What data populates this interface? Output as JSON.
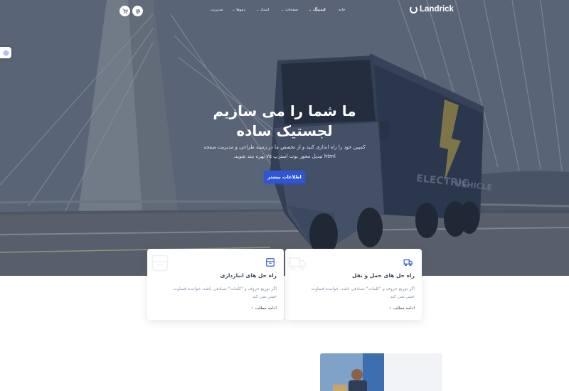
{
  "brand": {
    "name": "Landrick"
  },
  "nav": {
    "items": [
      {
        "label": "خانه",
        "active": false,
        "caret": false
      },
      {
        "label": "لندینگ",
        "active": true,
        "caret": true
      },
      {
        "label": "صفحات",
        "active": false,
        "caret": true
      },
      {
        "label": "اسناد",
        "active": false,
        "caret": true
      },
      {
        "label": "دموها",
        "active": false,
        "caret": true
      },
      {
        "label": "مدیریت",
        "active": false,
        "caret": false
      }
    ],
    "caret_glyph": "⌄"
  },
  "icons": {
    "cart": "cart-icon",
    "settings": "gear-icon",
    "side_settings": "gear-icon"
  },
  "hero": {
    "title_line1": "ما شما را می سازیم",
    "title_line2": "لجستیک ساده",
    "subtitle_line1": "کمپین خود را راه اندازی کنید و از تخصص ما در زمینه طراحی و مدیریت صفحه",
    "subtitle_line2": "html تبدیل محور بوت استرپ ۷۵ بهره مند شوید.",
    "button_label": "اطلاعات بیشتر"
  },
  "cards": [
    {
      "title": "راه حل های حمل و نقل",
      "text_line1": "اگر توزیع حروف و \"کلمات\" تصادفی باشد، خواننده قضاوت",
      "text_line2": "خنثی نمی کند",
      "link": "ادامه مطلب",
      "icon": "truck-icon"
    },
    {
      "title": "راه حل های انبارداری",
      "text_line1": "اگر توزیع حروف و \"کلمات\" تصادفی باشد، خواننده قضاوت",
      "text_line2": "خنثی نمی کند",
      "link": "ادامه مطلب",
      "icon": "box-icon"
    }
  ],
  "colors": {
    "primary": "#2f55d4",
    "heading": "#3c4858",
    "muted": "#8492a6",
    "hero_overlay": "#283448"
  }
}
